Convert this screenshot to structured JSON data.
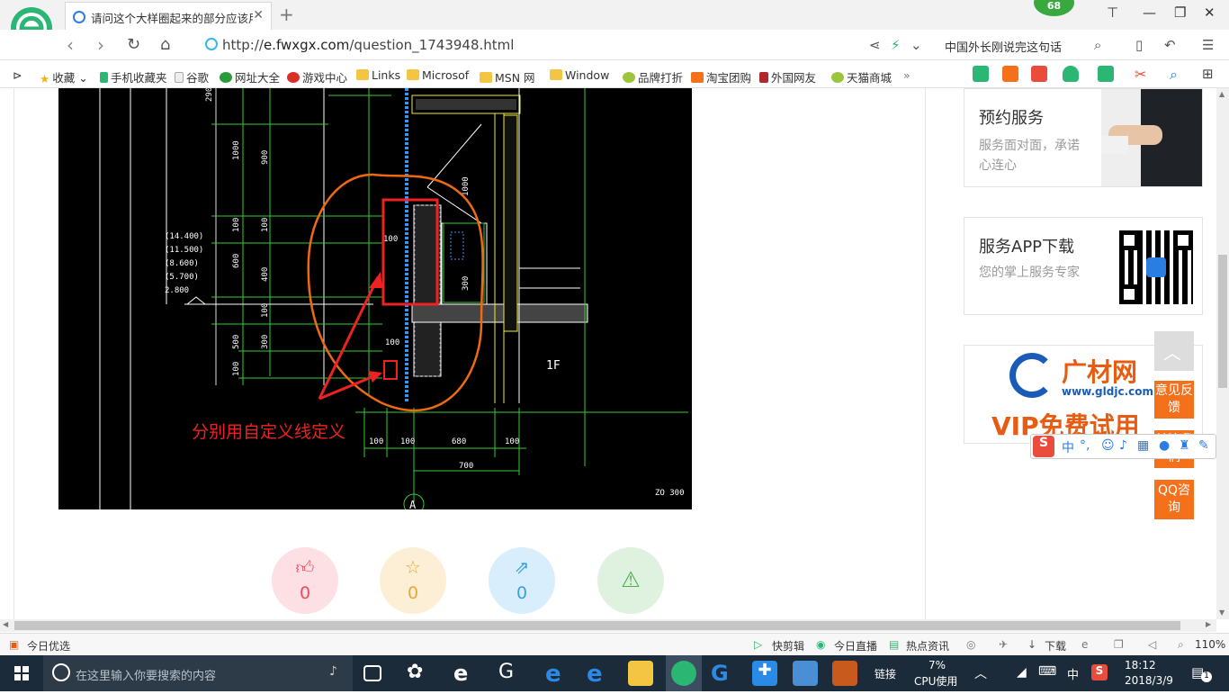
{
  "tab": {
    "title": "请问这个大样圈起来的部分应该用"
  },
  "badge": {
    "count": "68"
  },
  "address": {
    "url_prefix": "http://",
    "url_host": "e.fwxgx.com",
    "url_path": "/question_1743948.html",
    "search_text": "中国外长刚说完这句话"
  },
  "bookmarks": [
    {
      "label": "收藏",
      "icon": "star-icon"
    },
    {
      "label": "手机收藏夹",
      "icon": "phone-icon"
    },
    {
      "label": "谷歌",
      "icon": "page-icon"
    },
    {
      "label": "网址大全",
      "icon": "globe-icon"
    },
    {
      "label": "游戏中心",
      "icon": "game-icon"
    },
    {
      "label": "Links",
      "icon": "folder-icon"
    },
    {
      "label": "Microsof",
      "icon": "folder-icon"
    },
    {
      "label": "MSN 网",
      "icon": "folder-icon"
    },
    {
      "label": "Window",
      "icon": "folder-icon"
    },
    {
      "label": "品牌打折",
      "icon": "leaf-icon"
    },
    {
      "label": "淘宝团购",
      "icon": "taobao-icon"
    },
    {
      "label": "外国网友",
      "icon": "flag-icon"
    },
    {
      "label": "天猫商城",
      "icon": "leaf-icon"
    }
  ],
  "cad": {
    "annotation": "分别用自定义线定义",
    "elevations": [
      "(14.400)",
      "(11.500)",
      "(8.600)",
      "(5.700)",
      "2.800"
    ],
    "dims_top": [
      "290",
      "1000",
      "900",
      "1000"
    ],
    "dims_left": [
      "100",
      "100",
      "600",
      "400",
      "100",
      "500",
      "300",
      "100"
    ],
    "dims_bottom": [
      "100",
      "100",
      "680",
      "100",
      "700"
    ],
    "dims_mid": [
      "100",
      "100",
      "100",
      "300"
    ],
    "floor_label": "1F",
    "axis_label": "A",
    "scale": "ZO 300"
  },
  "actions": [
    {
      "name": "like",
      "count": "0",
      "color": "#e84a5f",
      "bg": "#fde0e4"
    },
    {
      "name": "favorite",
      "count": "0",
      "color": "#e8a838",
      "bg": "#fdefd6"
    },
    {
      "name": "share",
      "count": "0",
      "color": "#3aa0e0",
      "bg": "#d9eefc"
    },
    {
      "name": "report",
      "count": "",
      "color": "#4cb050",
      "bg": "#dff2df"
    }
  ],
  "sidebar": {
    "service_title": "预约服务",
    "service_desc": "服务面对面，承诺心连心",
    "app_title": "服务APP下载",
    "app_desc": "您的掌上服务专家",
    "ad_logo": "广材网",
    "ad_url": "www.gldjc.com",
    "ad_slogan": "VIP免费试用"
  },
  "floatbar": {
    "feedback": "意见反馈",
    "follow": "关注我们",
    "qq": "QQ咨询"
  },
  "ime": {
    "mode": "中"
  },
  "statusbar": {
    "left": "今日优选",
    "items": [
      "快剪辑",
      "今日直播",
      "热点资讯",
      "下载"
    ],
    "zoom": "110%"
  },
  "taskbar": {
    "search_placeholder": "在这里输入你要搜索的内容",
    "link_label": "链接",
    "cpu_pct": "7%",
    "cpu_label": "CPU使用",
    "ime": "中",
    "time": "18:12",
    "date": "2018/3/9",
    "notif": "1"
  }
}
